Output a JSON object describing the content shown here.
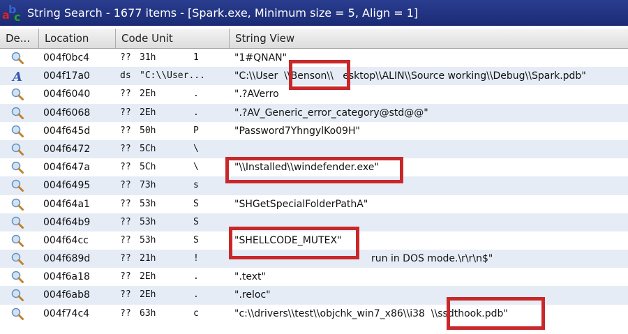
{
  "window": {
    "title": "String Search - 1677 items - [Spark.exe, Minimum size = 5, Align = 1]"
  },
  "columns": [
    "De...",
    "Location",
    "Code Unit",
    "String View"
  ],
  "rows": [
    {
      "icon": "search",
      "loc": "004f0bc4",
      "cu1": "??",
      "cu2": "31h",
      "cu3": "1",
      "str": "\"1#QNAN\""
    },
    {
      "icon": "text",
      "loc": "004f17a0",
      "cu1": "ds",
      "cu2": "\"C:\\\\User...",
      "cu3": "",
      "str": "\"C:\\\\User  \\\\Benson\\\\   esktop\\\\ALIN\\\\Source working\\\\Debug\\\\Spark.pdb\""
    },
    {
      "icon": "search",
      "loc": "004f6040",
      "cu1": "??",
      "cu2": "2Eh",
      "cu3": ".",
      "str": "\".?AVerro"
    },
    {
      "icon": "search",
      "loc": "004f6068",
      "cu1": "??",
      "cu2": "2Eh",
      "cu3": ".",
      "str": "\".?AV_Generic_error_category@std@@\""
    },
    {
      "icon": "search",
      "loc": "004f645d",
      "cu1": "??",
      "cu2": "50h",
      "cu3": "P",
      "str": "\"Password7YhngylKo09H\""
    },
    {
      "icon": "search",
      "loc": "004f6472",
      "cu1": "??",
      "cu2": "5Ch",
      "cu3": "\\",
      "str": ""
    },
    {
      "icon": "search",
      "loc": "004f647a",
      "cu1": "??",
      "cu2": "5Ch",
      "cu3": "\\",
      "str": "\"\\\\Installed\\\\windefender.exe\""
    },
    {
      "icon": "search",
      "loc": "004f6495",
      "cu1": "??",
      "cu2": "73h",
      "cu3": "s",
      "str": ""
    },
    {
      "icon": "search",
      "loc": "004f64a1",
      "cu1": "??",
      "cu2": "53h",
      "cu3": "S",
      "str": "\"SHGetSpecialFolderPathA\""
    },
    {
      "icon": "search",
      "loc": "004f64b9",
      "cu1": "??",
      "cu2": "53h",
      "cu3": "S",
      "str": ""
    },
    {
      "icon": "search",
      "loc": "004f64cc",
      "cu1": "??",
      "cu2": "53h",
      "cu3": "S",
      "str": "\"SHELLCODE_MUTEX\""
    },
    {
      "icon": "search",
      "loc": "004f689d",
      "cu1": "??",
      "cu2": "21h",
      "cu3": "!",
      "str": "run in DOS mode.\\r\\r\\n$\""
    },
    {
      "icon": "search",
      "loc": "004f6a18",
      "cu1": "??",
      "cu2": "2Eh",
      "cu3": ".",
      "str": "\".text\""
    },
    {
      "icon": "search",
      "loc": "004f6ab8",
      "cu1": "??",
      "cu2": "2Eh",
      "cu3": ".",
      "str": "\".reloc\""
    },
    {
      "icon": "search",
      "loc": "004f74c4",
      "cu1": "??",
      "cu2": "63h",
      "cu3": "c",
      "str": "\"c:\\\\drivers\\\\test\\\\objchk_win7_x86\\\\i38  \\\\ssdthook.pdb\""
    }
  ],
  "colors": {
    "highlight": "#c8282a",
    "title_bg": "#1a2a75"
  }
}
